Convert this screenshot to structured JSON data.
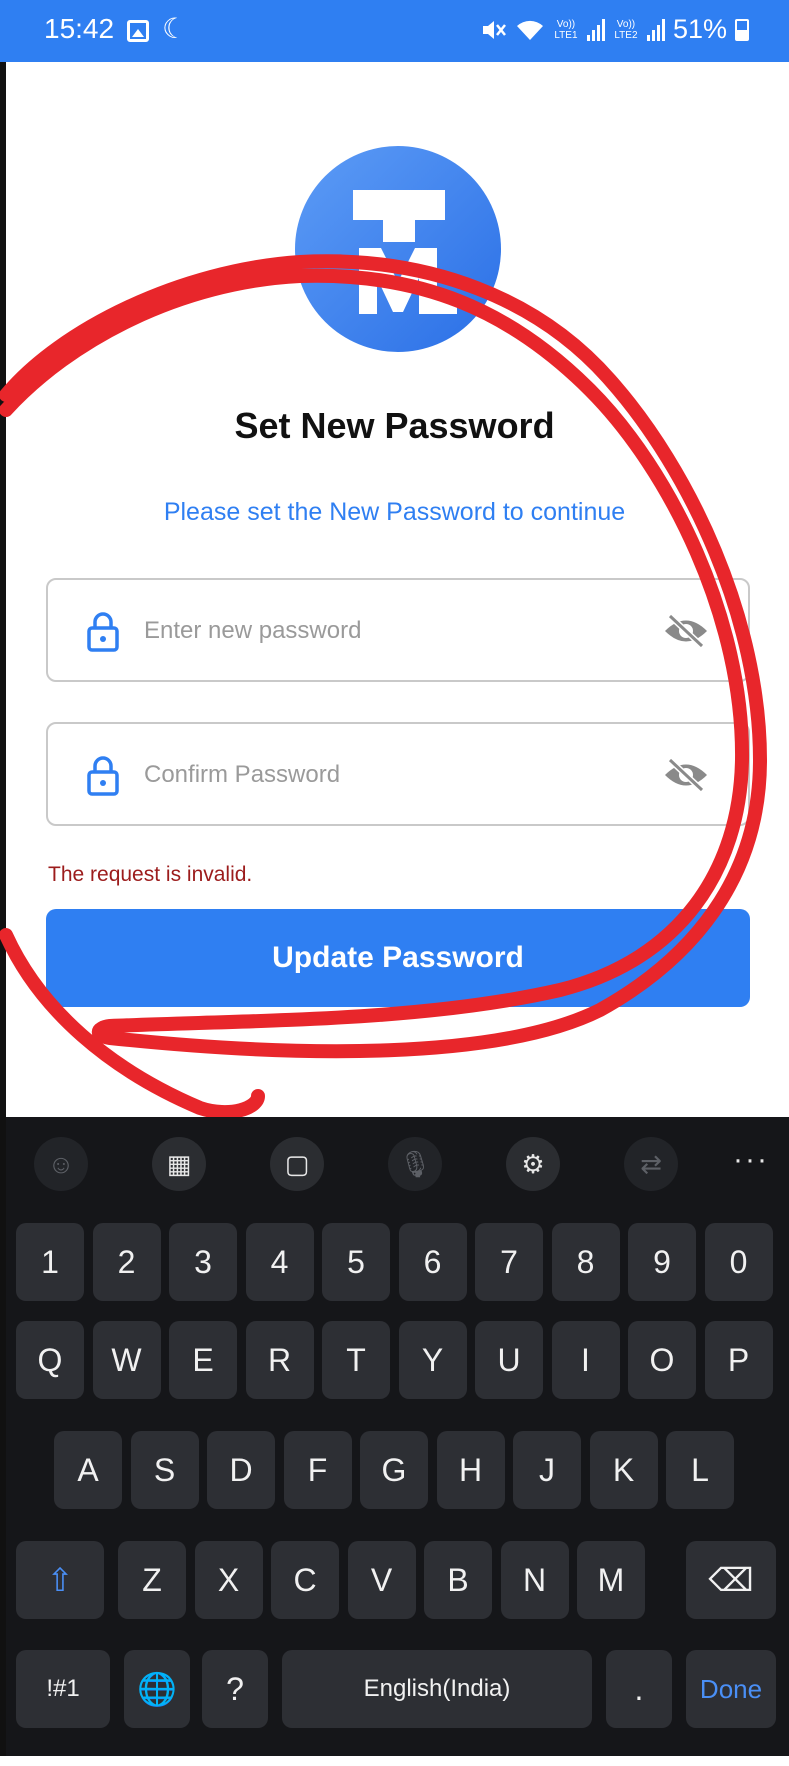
{
  "status_bar": {
    "time": "15:42",
    "battery": "51%",
    "moon_icon": "☾",
    "mute_icon": "🔇",
    "wifi_icon": "📶",
    "volte1": "Vo)) LTE1",
    "volte2": "Vo)) LTE2"
  },
  "page": {
    "title": "Set New Password",
    "subtitle": "Please set the New Password to continue",
    "new_password_placeholder": "Enter new password",
    "confirm_password_placeholder": "Confirm Password",
    "error_message": "The request is invalid.",
    "update_button_label": "Update Password"
  },
  "colors": {
    "primary": "#2f7ff2",
    "error": "#9c1c1c",
    "annotation": "#e8262b",
    "keyboard_bg": "#151619"
  },
  "keyboard": {
    "toolbar": [
      {
        "name": "emoji-icon",
        "glyph": "☺"
      },
      {
        "name": "keypad-icon",
        "glyph": "▦"
      },
      {
        "name": "clipboard-icon",
        "glyph": "▢"
      },
      {
        "name": "microphone-icon",
        "glyph": "🎙"
      },
      {
        "name": "settings-icon",
        "glyph": "⚙"
      },
      {
        "name": "translate-icon",
        "glyph": "⇄"
      }
    ],
    "more_label": "···",
    "row_numbers": [
      "1",
      "2",
      "3",
      "4",
      "5",
      "6",
      "7",
      "8",
      "9",
      "0"
    ],
    "row_top": [
      "Q",
      "W",
      "E",
      "R",
      "T",
      "Y",
      "U",
      "I",
      "O",
      "P"
    ],
    "row_middle": [
      "A",
      "S",
      "D",
      "F",
      "G",
      "H",
      "J",
      "K",
      "L"
    ],
    "row_bottom": [
      "Z",
      "X",
      "C",
      "V",
      "B",
      "N",
      "M"
    ],
    "shift_label": "⇧",
    "backspace_label": "⌫",
    "symbols_label": "!#1",
    "globe_label": "🌐",
    "question_label": "?",
    "space_label": "English(India)",
    "period_label": ".",
    "done_label": "Done"
  }
}
